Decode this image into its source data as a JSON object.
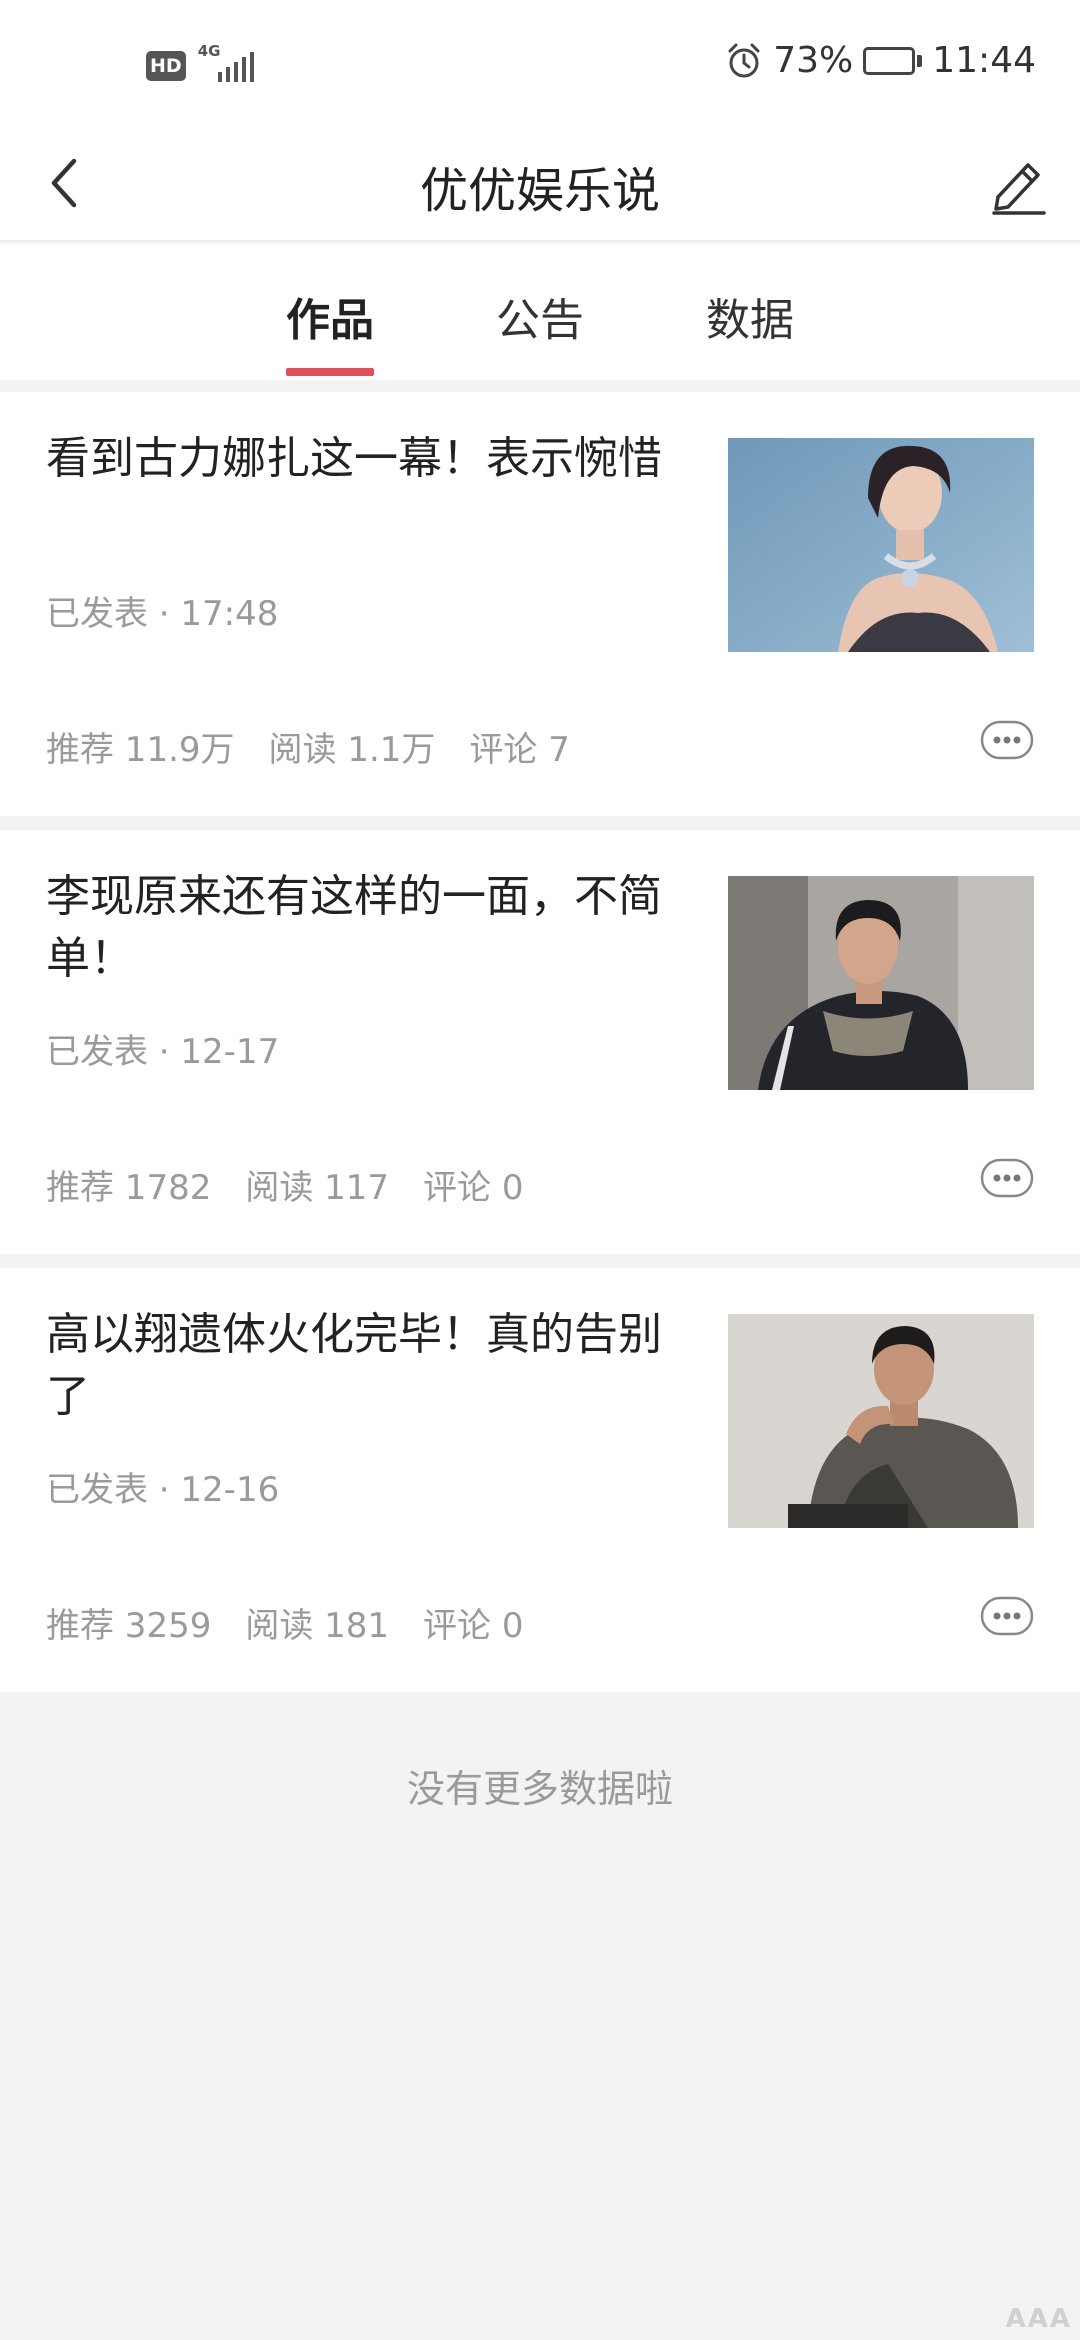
{
  "status_bar": {
    "hd_label": "HD",
    "network_label": "4G",
    "alarm_icon": "alarm-clock-icon",
    "battery_percent": "73%",
    "battery_level": 0.73,
    "time": "11:44"
  },
  "navbar": {
    "back_icon": "chevron-left-icon",
    "title": "优优娱乐说",
    "edit_icon": "pencil-edit-icon"
  },
  "tabs": [
    {
      "label": "作品",
      "active": true
    },
    {
      "label": "公告",
      "active": false
    },
    {
      "label": "数据",
      "active": false
    }
  ],
  "colors": {
    "accent": "#e0505a",
    "muted_text": "#9a9a9a",
    "background": "#f3f3f4"
  },
  "articles": [
    {
      "title": "看到古力娜扎这一幕！表示惋惜",
      "meta": "已发表 · 17:48",
      "stats": {
        "recommend": "推荐 11.9万",
        "read": "阅读 1.1万",
        "comment": "评论 7"
      },
      "more_icon": "more-dots-icon"
    },
    {
      "title": "李现原来还有这样的一面，不简单！",
      "meta": "已发表 · 12-17",
      "stats": {
        "recommend": "推荐 1782",
        "read": "阅读 117",
        "comment": "评论 0"
      },
      "more_icon": "more-dots-icon"
    },
    {
      "title": "高以翔遗体火化完毕！真的告别了",
      "meta": "已发表 · 12-16",
      "stats": {
        "recommend": "推荐 3259",
        "read": "阅读 181",
        "comment": "评论 0"
      },
      "more_icon": "more-dots-icon"
    }
  ],
  "footer": {
    "no_more_text": "没有更多数据啦",
    "watermark": "AAA"
  }
}
